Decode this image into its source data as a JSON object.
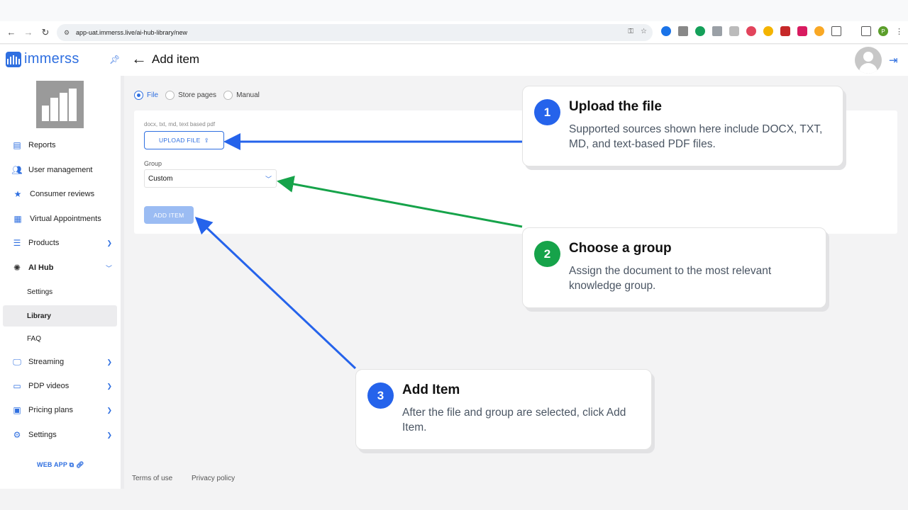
{
  "browser": {
    "url": "app-uat.immerss.live/ai-hub-library/new"
  },
  "header": {
    "brand": "immerss",
    "title": "Add item"
  },
  "sidebar": {
    "items": [
      {
        "label": "Reports",
        "icon": "reports-icon"
      },
      {
        "label": "User management",
        "icon": "users-icon"
      },
      {
        "label": "Consumer reviews",
        "icon": "star-icon"
      },
      {
        "label": "Virtual Appointments",
        "icon": "calendar-icon"
      },
      {
        "label": "Products",
        "icon": "list-icon"
      },
      {
        "label": "AI Hub",
        "icon": "ai-brain-icon"
      },
      {
        "label": "Streaming",
        "icon": "monitor-icon"
      },
      {
        "label": "PDP videos",
        "icon": "video-icon"
      },
      {
        "label": "Pricing plans",
        "icon": "pricing-icon"
      },
      {
        "label": "Settings",
        "icon": "gear-icon"
      }
    ],
    "ai_hub_sub": [
      "Settings",
      "Library",
      "FAQ"
    ],
    "web_app": "WEB APP"
  },
  "form": {
    "source_options": [
      "File",
      "Store pages",
      "Manual"
    ],
    "selected_source": "File",
    "hint": "docx, txt, md, text based pdf",
    "upload_label": "UPLOAD FILE",
    "group_label": "Group",
    "group_value": "Custom",
    "add_label": "ADD ITEM"
  },
  "footer": {
    "terms": "Terms of use",
    "privacy": "Privacy policy"
  },
  "callouts": [
    {
      "num": "1",
      "title": "Upload the file",
      "body": "Supported sources shown here include DOCX, TXT, MD, and text-based PDF files.",
      "color": "#2563eb"
    },
    {
      "num": "2",
      "title": "Choose a group",
      "body": "Assign the document to the most relevant knowledge group.",
      "color": "#16a34a"
    },
    {
      "num": "3",
      "title": "Add Item",
      "body": "After the file and group are selected, click Add Item.",
      "color": "#2563eb"
    }
  ],
  "colors": {
    "accent": "#2f6fe0",
    "arrow_blue": "#2563eb",
    "arrow_green": "#16a34a"
  }
}
